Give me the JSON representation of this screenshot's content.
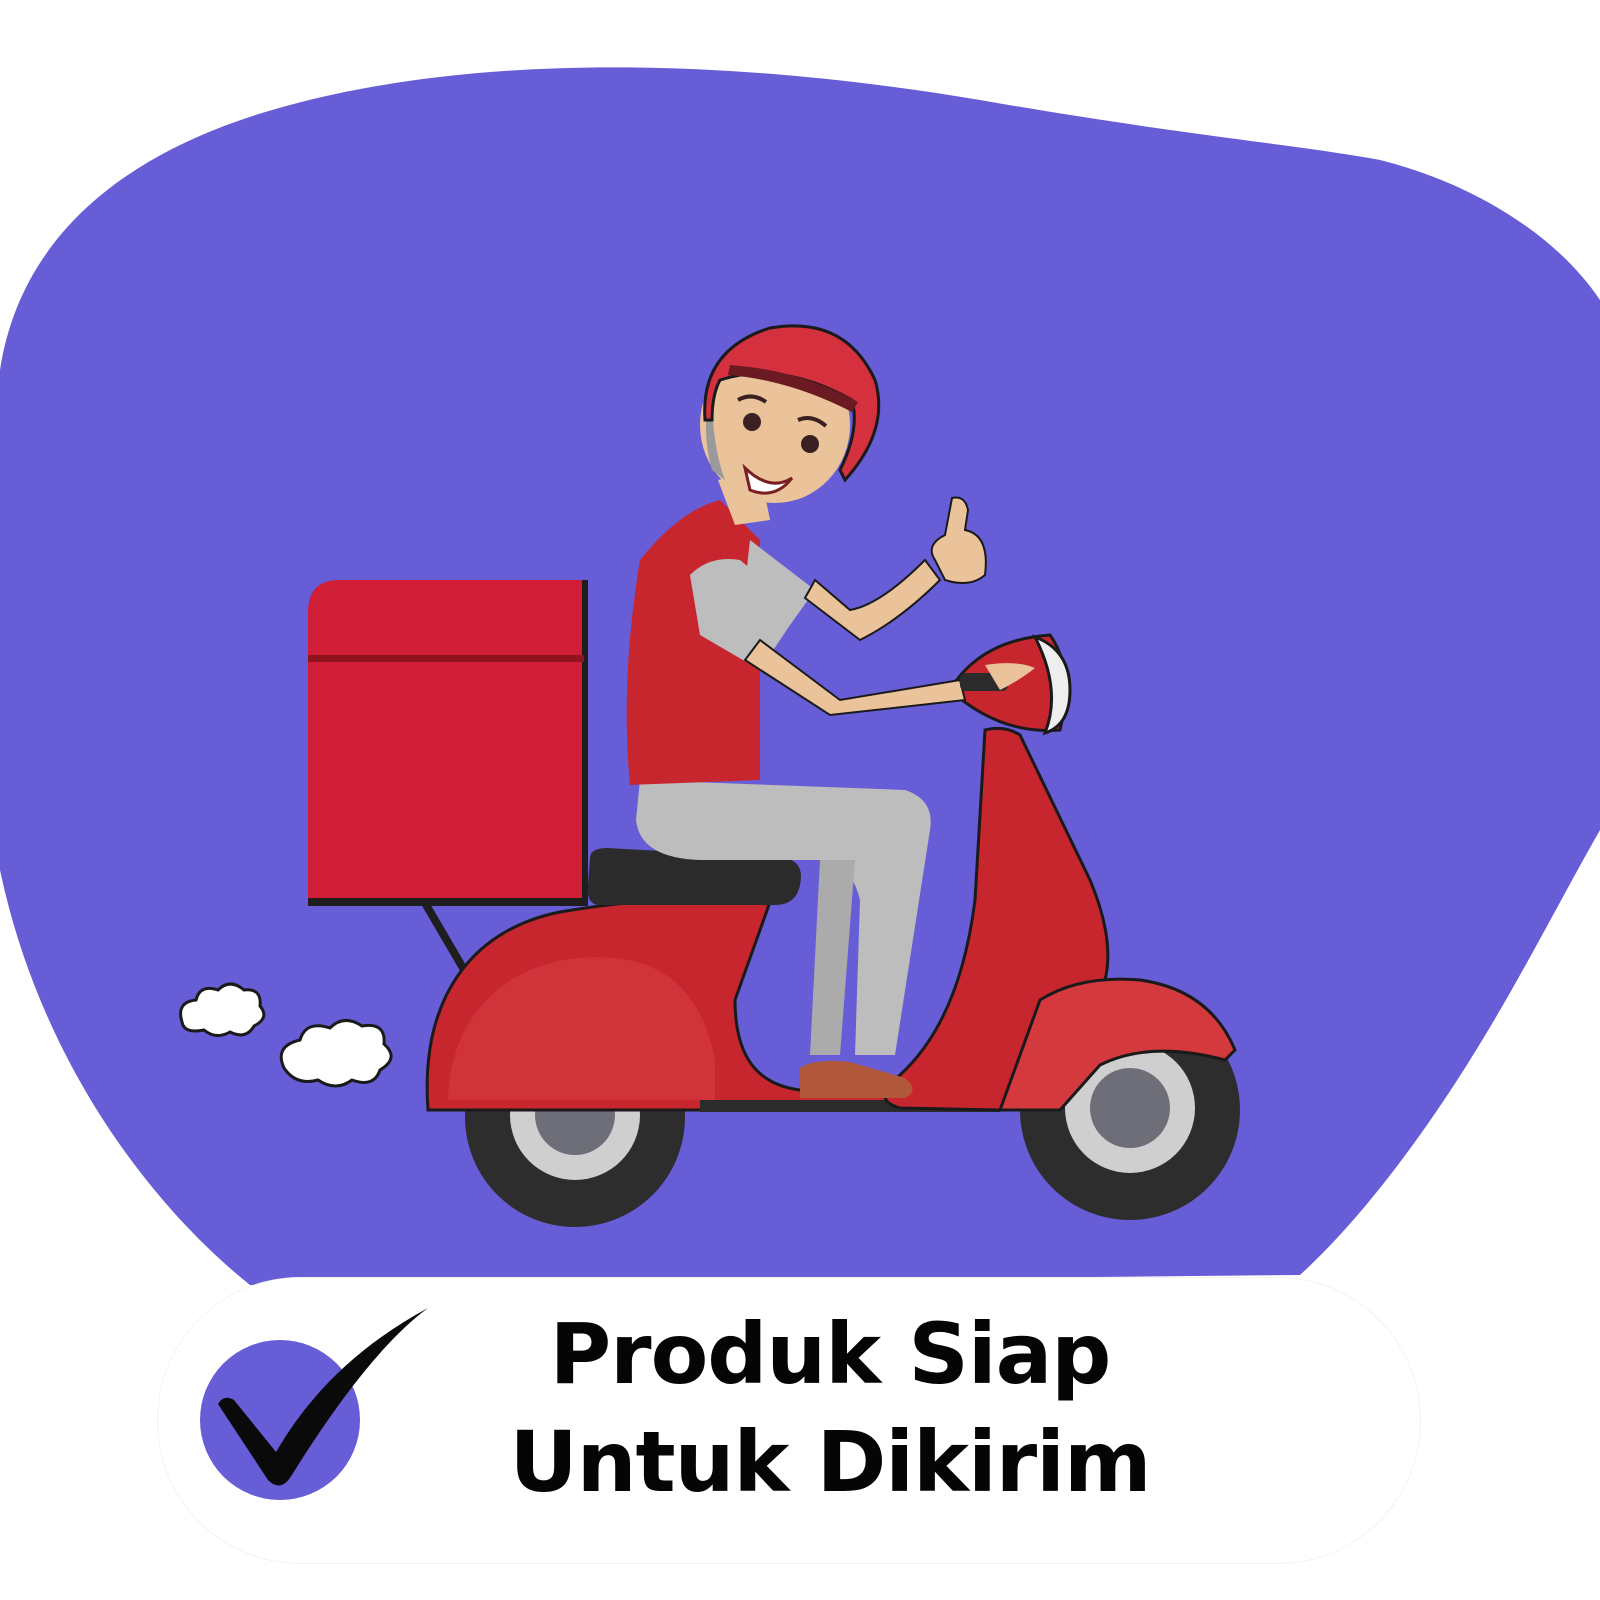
{
  "caption": {
    "line1": "Produk Siap",
    "line2": "Untuk Dikirim"
  },
  "icons": [
    "delivery-rider-illustration",
    "checkmark-icon"
  ],
  "colors": {
    "blob": "#675DD7",
    "scooter_red": "#C8262F",
    "box_red": "#D01E36",
    "helmet_red": "#D4303E",
    "badge_circle": "#675DD7",
    "text": "#050505"
  }
}
